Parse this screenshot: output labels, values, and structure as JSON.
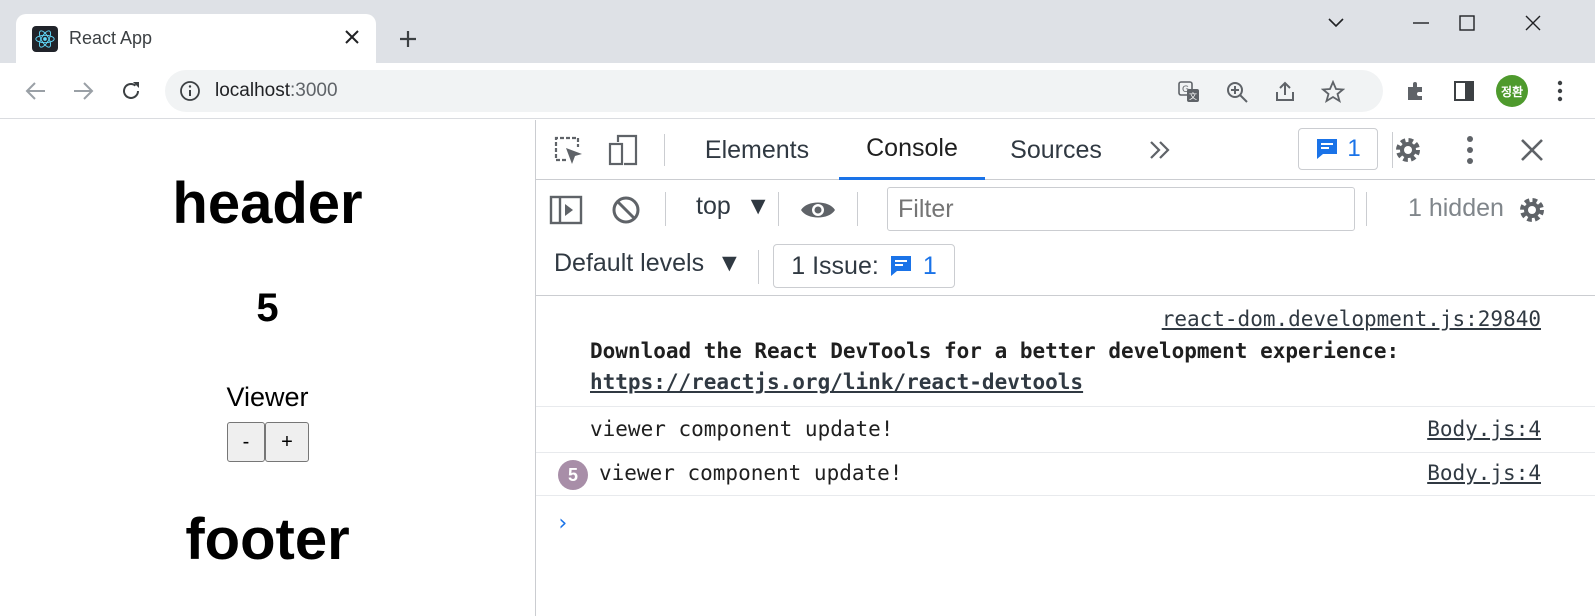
{
  "browser": {
    "tab_title": "React App",
    "url_host": "localhost",
    "url_port": ":3000",
    "avatar_text": "정환"
  },
  "app": {
    "header": "header",
    "count": "5",
    "viewer_label": "Viewer",
    "minus_label": "-",
    "plus_label": "+",
    "footer": "footer"
  },
  "devtools": {
    "tabs": [
      "Elements",
      "Console",
      "Sources"
    ],
    "active_tab": "Console",
    "issue_count": "1",
    "context": "top",
    "filter_placeholder": "Filter",
    "hidden_text": "1 hidden",
    "levels_label": "Default levels",
    "issue_label": "1 Issue:",
    "issue_badge_count": "1",
    "messages": [
      {
        "source": "react-dom.development.js:29840",
        "text": "Download the React DevTools for a better development experience:",
        "link": "https://reactjs.org/link/react-devtools"
      },
      {
        "source": "Body.js:4",
        "text": "viewer component update!"
      },
      {
        "source": "Body.js:4",
        "text": "viewer component update!",
        "repeat": "5"
      }
    ],
    "prompt": "›"
  },
  "colors": {
    "accent": "#1a73e8",
    "tabstrip": "#dee1e6",
    "repeat_badge": "#a88ea8",
    "avatar": "#4e9a2d"
  }
}
